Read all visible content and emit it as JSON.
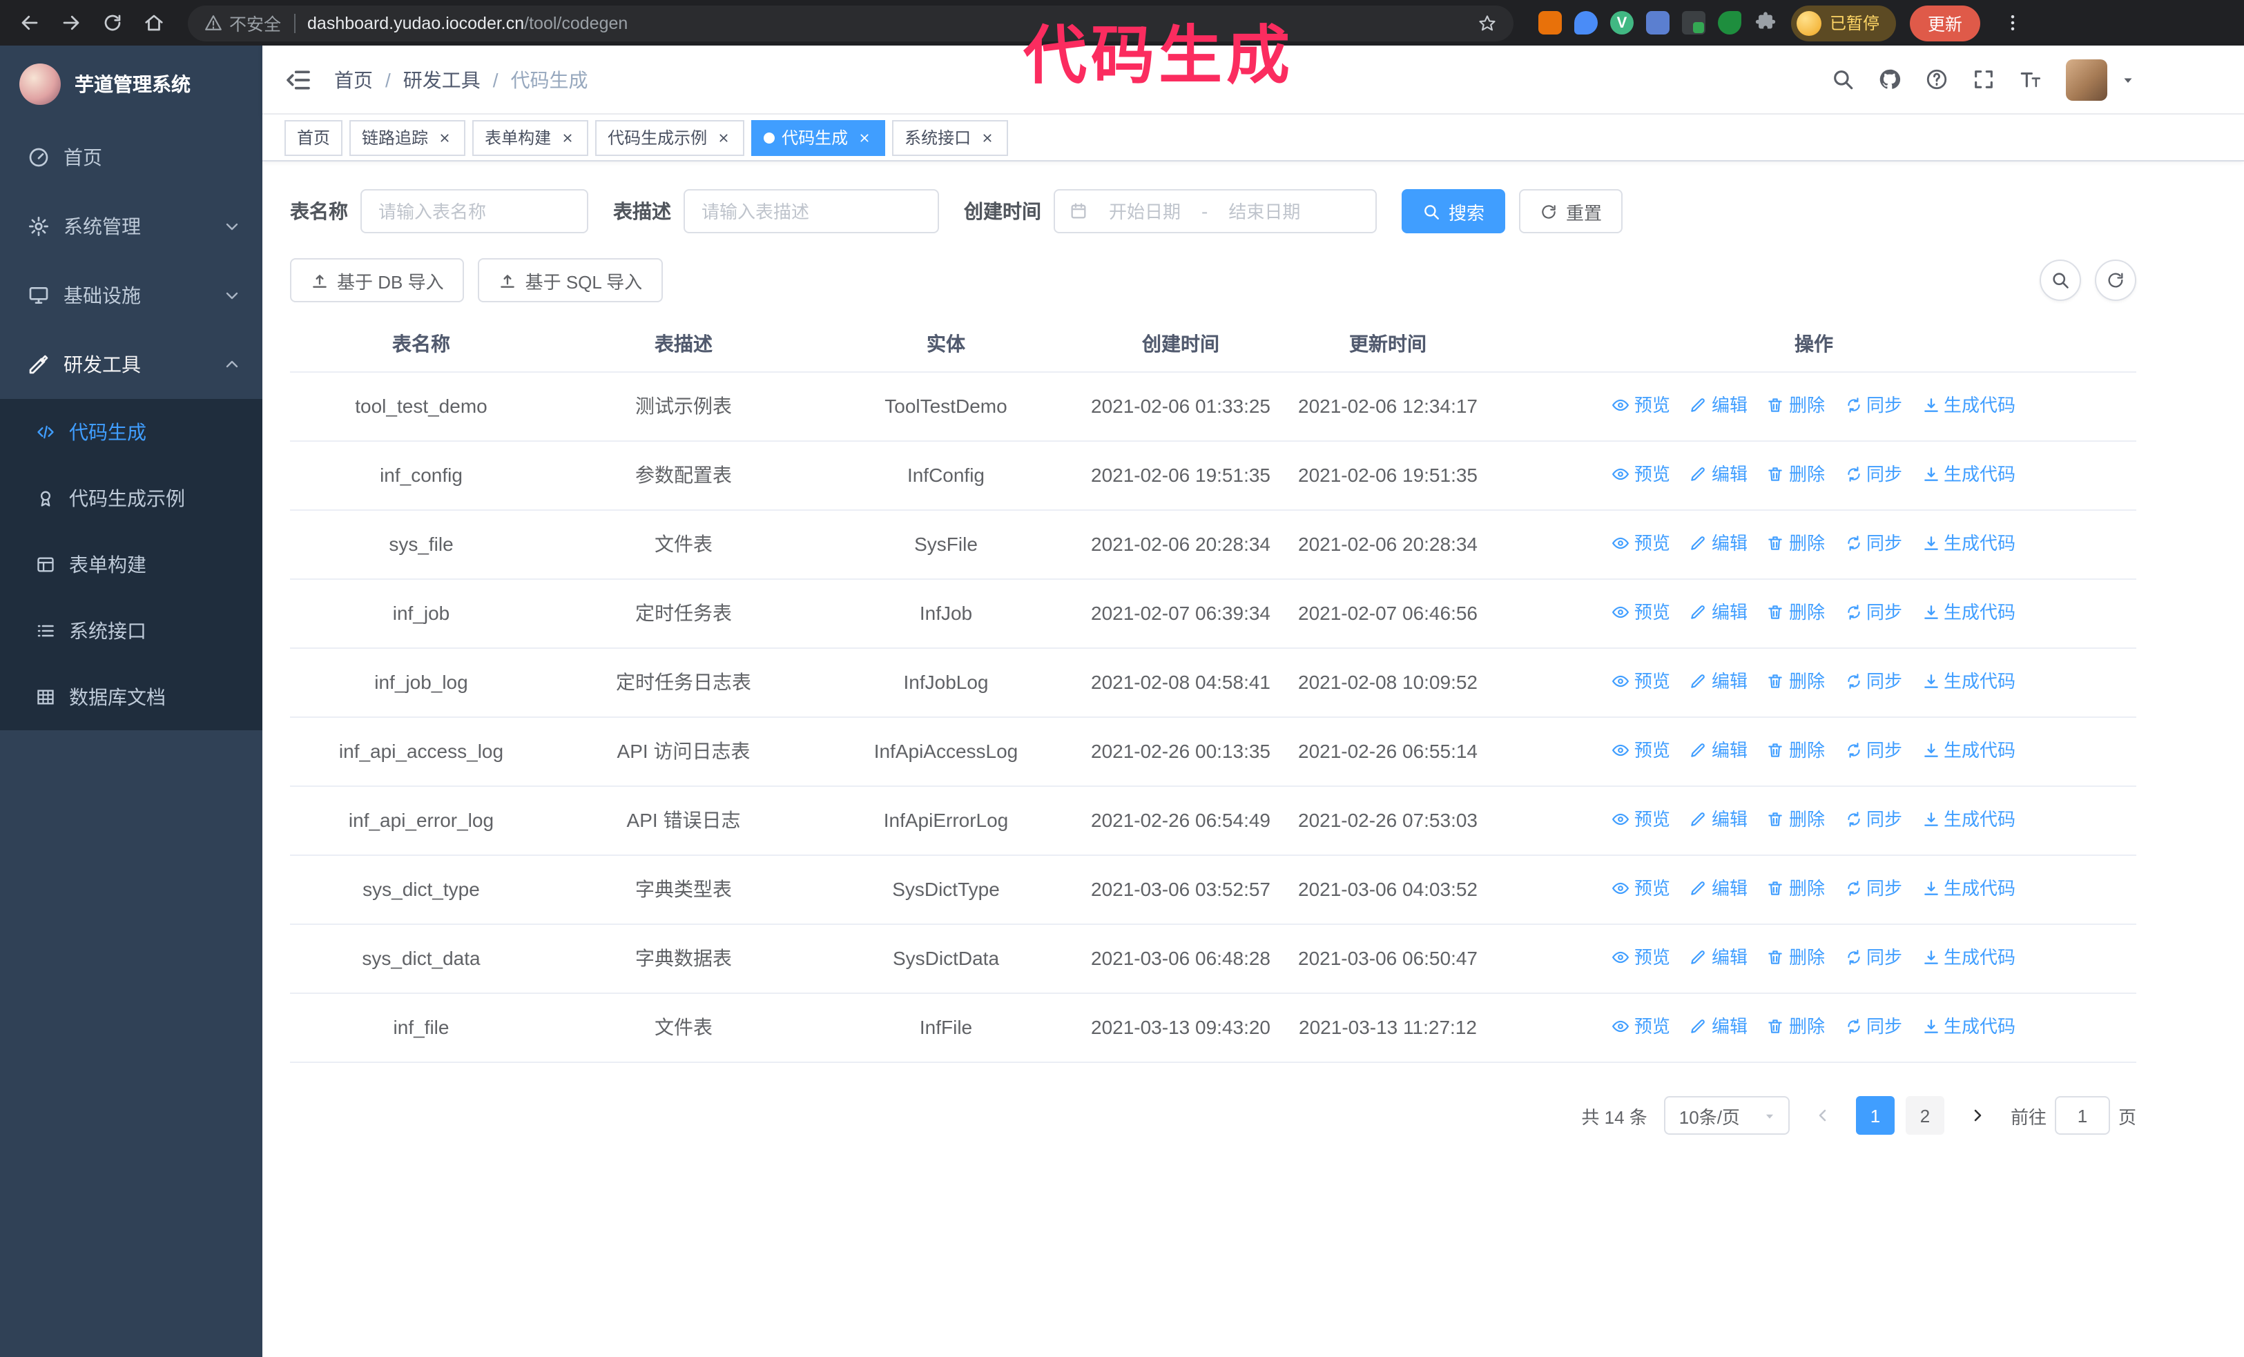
{
  "browser": {
    "security_text": "不安全",
    "url_domain": "dashboard.yudao.iocoder.cn",
    "url_path": "/tool/codegen",
    "profile_badge": "已暂停",
    "update_label": "更新"
  },
  "annotation": "代码生成",
  "colors": {
    "accent": "#409eff",
    "sidebar_bg": "#304156",
    "submenu_bg": "#1f2d3d",
    "annotation": "#fb2c5f",
    "update_button": "#df5a49"
  },
  "sidebar": {
    "title": "芋道管理系统",
    "items": [
      {
        "label": "首页"
      },
      {
        "label": "系统管理"
      },
      {
        "label": "基础设施"
      },
      {
        "label": "研发工具"
      }
    ],
    "submenu": [
      {
        "label": "代码生成"
      },
      {
        "label": "代码生成示例"
      },
      {
        "label": "表单构建"
      },
      {
        "label": "系统接口"
      },
      {
        "label": "数据库文档"
      }
    ]
  },
  "breadcrumb": {
    "separator": "/",
    "items": [
      "首页",
      "研发工具",
      "代码生成"
    ]
  },
  "tabs": [
    {
      "label": "首页"
    },
    {
      "label": "链路追踪"
    },
    {
      "label": "表单构建"
    },
    {
      "label": "代码生成示例"
    },
    {
      "label": "代码生成"
    },
    {
      "label": "系统接口"
    }
  ],
  "filters": {
    "table_name_label": "表名称",
    "table_name_placeholder": "请输入表名称",
    "table_desc_label": "表描述",
    "table_desc_placeholder": "请输入表描述",
    "create_time_label": "创建时间",
    "date_start_placeholder": "开始日期",
    "date_separator": "-",
    "date_end_placeholder": "结束日期",
    "search_button": "搜索",
    "reset_button": "重置"
  },
  "toolbar": {
    "import_db": "基于 DB 导入",
    "import_sql": "基于 SQL 导入"
  },
  "table": {
    "columns": [
      "表名称",
      "表描述",
      "实体",
      "创建时间",
      "更新时间",
      "操作"
    ],
    "actions": [
      "预览",
      "编辑",
      "删除",
      "同步",
      "生成代码"
    ],
    "rows": [
      {
        "name": "tool_test_demo",
        "desc": "测试示例表",
        "entity": "ToolTestDemo",
        "created": "2021-02-06 01:33:25",
        "updated": "2021-02-06 12:34:17"
      },
      {
        "name": "inf_config",
        "desc": "参数配置表",
        "entity": "InfConfig",
        "created": "2021-02-06 19:51:35",
        "updated": "2021-02-06 19:51:35"
      },
      {
        "name": "sys_file",
        "desc": "文件表",
        "entity": "SysFile",
        "created": "2021-02-06 20:28:34",
        "updated": "2021-02-06 20:28:34"
      },
      {
        "name": "inf_job",
        "desc": "定时任务表",
        "entity": "InfJob",
        "created": "2021-02-07 06:39:34",
        "updated": "2021-02-07 06:46:56"
      },
      {
        "name": "inf_job_log",
        "desc": "定时任务日志表",
        "entity": "InfJobLog",
        "created": "2021-02-08 04:58:41",
        "updated": "2021-02-08 10:09:52"
      },
      {
        "name": "inf_api_access_log",
        "desc": "API 访问日志表",
        "entity": "InfApiAccessLog",
        "created": "2021-02-26 00:13:35",
        "updated": "2021-02-26 06:55:14"
      },
      {
        "name": "inf_api_error_log",
        "desc": "API 错误日志",
        "entity": "InfApiErrorLog",
        "created": "2021-02-26 06:54:49",
        "updated": "2021-02-26 07:53:03"
      },
      {
        "name": "sys_dict_type",
        "desc": "字典类型表",
        "entity": "SysDictType",
        "created": "2021-03-06 03:52:57",
        "updated": "2021-03-06 04:03:52"
      },
      {
        "name": "sys_dict_data",
        "desc": "字典数据表",
        "entity": "SysDictData",
        "created": "2021-03-06 06:48:28",
        "updated": "2021-03-06 06:50:47"
      },
      {
        "name": "inf_file",
        "desc": "文件表",
        "entity": "InfFile",
        "created": "2021-03-13 09:43:20",
        "updated": "2021-03-13 11:27:12"
      }
    ]
  },
  "pagination": {
    "total": "共 14 条",
    "page_size": "10条/页",
    "pages": [
      "1",
      "2"
    ],
    "goto_label": "前往",
    "goto_value": "1",
    "goto_unit": "页"
  }
}
